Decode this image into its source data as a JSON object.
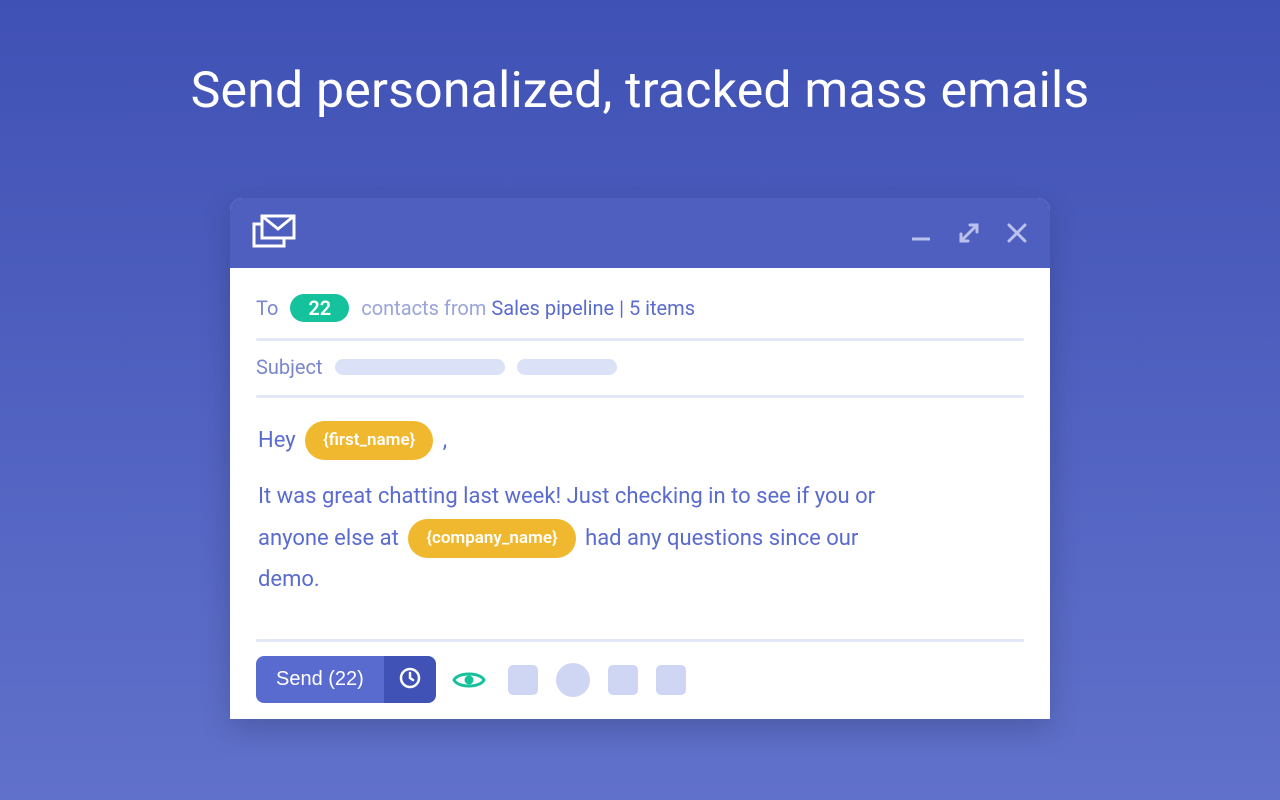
{
  "headline": "Send personalized, tracked mass emails",
  "compose": {
    "to": {
      "label": "To",
      "count": "22",
      "prefix": "contacts from",
      "source": "Sales pipeline | 5 items"
    },
    "subject": {
      "label": "Subject"
    },
    "body": {
      "greeting_prefix": "Hey",
      "token_first_name": "{first_name}",
      "greeting_suffix": ",",
      "line2a": "It was great chatting last week!  Just checking in to see if you or",
      "line3a": "anyone else at",
      "token_company": "{company_name}",
      "line3b": "had any questions since our",
      "line4": "demo."
    },
    "footer": {
      "send_label": "Send (22)"
    }
  }
}
